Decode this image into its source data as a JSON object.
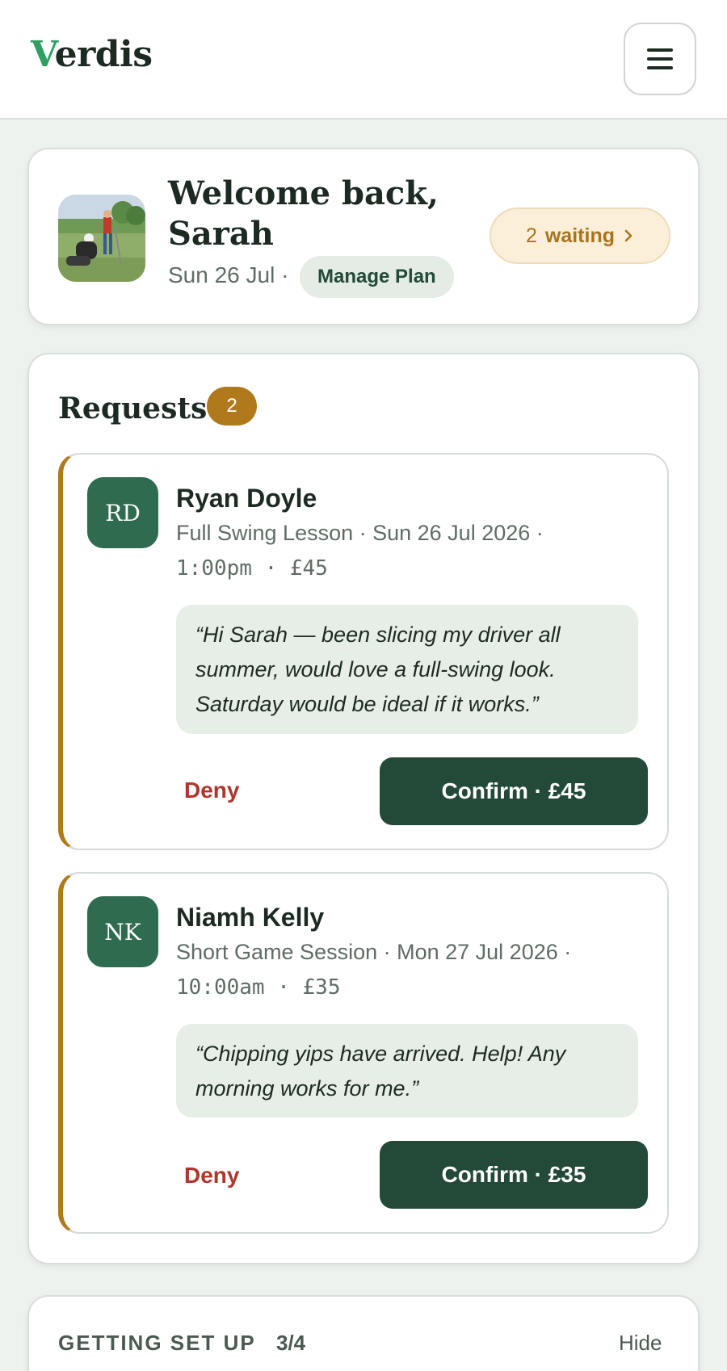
{
  "app": {
    "logo_first": "V",
    "logo_rest": "erdis"
  },
  "header": {
    "menu_icon": "hamburger-icon"
  },
  "welcome": {
    "title": "Welcome back, Sarah",
    "date": "Sun 26 Jul ·",
    "manage_plan": "Manage Plan",
    "waiting_count": "2",
    "waiting_label": "waiting",
    "waiting_icon": "chevron-right-icon"
  },
  "requests": {
    "title": "Requests",
    "count": "2",
    "accent_color": "#b07a1c",
    "items": [
      {
        "initials": "RD",
        "name": "Ryan Doyle",
        "meta": "Full Swing Lesson · Sun 26 Jul 2026 ·",
        "time": "1:00pm · £45",
        "quote": "“Hi Sarah — been slicing my driver all summer, would love a full-swing look. Saturday would be ideal if it works.”",
        "deny": "Deny",
        "confirm": "Confirm · £45"
      },
      {
        "initials": "NK",
        "name": "Niamh Kelly",
        "meta": "Short Game Session · Mon 27 Jul 2026 ·",
        "time": "10:00am · £35",
        "quote": "“Chipping yips have arrived. Help! Any morning works for me.”",
        "deny": "Deny",
        "confirm": "Confirm · £35"
      }
    ]
  },
  "setup": {
    "title": "GETTING SET UP",
    "progress": "3/4",
    "hide": "Hide"
  },
  "colors": {
    "brand_green": "#234a38",
    "logo_accent": "#2e9e63",
    "deny_red": "#b0352a",
    "waiting_bg": "#fbefda"
  }
}
